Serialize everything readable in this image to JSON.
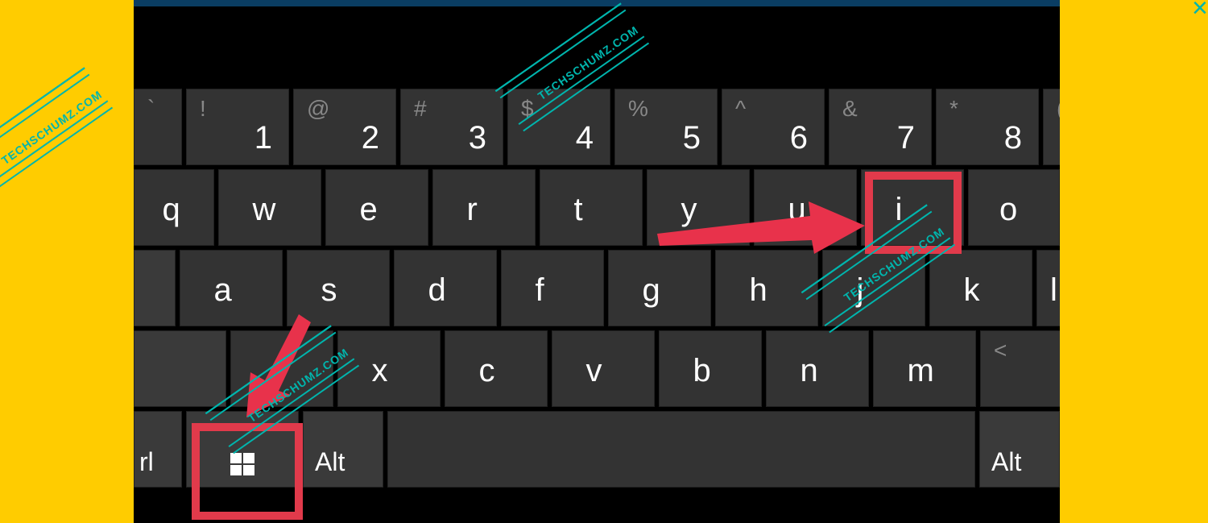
{
  "watermark": "TECHSCHUMZ.COM",
  "keys": {
    "row1": [
      {
        "sym": "`",
        "main": ""
      },
      {
        "sym": "!",
        "main": "1"
      },
      {
        "sym": "@",
        "main": "2"
      },
      {
        "sym": "#",
        "main": "3"
      },
      {
        "sym": "$",
        "main": "4"
      },
      {
        "sym": "%",
        "main": "5"
      },
      {
        "sym": "^",
        "main": "6"
      },
      {
        "sym": "&",
        "main": "7"
      },
      {
        "sym": "*",
        "main": "8"
      },
      {
        "sym": "(",
        "main": ""
      }
    ],
    "row2": [
      "q",
      "w",
      "e",
      "r",
      "t",
      "y",
      "u",
      "i",
      "o"
    ],
    "row3": [
      "a",
      "s",
      "d",
      "f",
      "g",
      "h",
      "j",
      "k",
      "l"
    ],
    "row4": {
      "letters": [
        "x",
        "c",
        "v",
        "b",
        "n",
        "m"
      ],
      "punct": {
        "sym": "<",
        "main": ""
      }
    },
    "row5": {
      "ctrl": "rl",
      "alt_left": "Alt",
      "space": "",
      "alt_right": "Alt"
    }
  },
  "highlights": [
    "key-i",
    "key-windows"
  ],
  "close_x": "×"
}
